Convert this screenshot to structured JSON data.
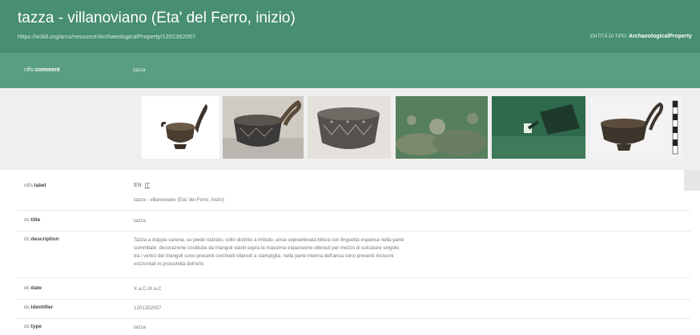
{
  "header": {
    "title": "tazza - villanoviano (Eta' del Ferro, inizio)",
    "uri": "https://w3id.org/arco/resource/ArchaeologicalProperty/1201352057",
    "entity_prefix": "ENTITÀ DI TIPO:",
    "entity_type": "ArchaeologicalProperty"
  },
  "comment": {
    "prefix": "rdfs:",
    "key": "comment",
    "value": "tazza"
  },
  "gallery": {
    "image_count": 6
  },
  "properties": {
    "label": {
      "prefix": "rdfs:",
      "key": "label",
      "lang_en": "EN",
      "lang_it": "IT",
      "value": "tazza - villanoviano (Eta' del Ferro, inizio)"
    },
    "title": {
      "prefix": "dc:",
      "key": "title",
      "value": "tazza"
    },
    "description": {
      "prefix": "dc:",
      "key": "description",
      "lines": [
        "Tazza a doppia carena, su piede rialzato, collo distinto a imbuto, ansa sopraelevata bifora con linguetta espansa nella parte",
        "sommitale; decorazione costituita da triangoli stanti sopra la massima espansione ottenuti per mezzo di solcature singole;",
        "tra i vertici dei triangoli sono presenti cerchielli ottenuti a stampiglia. nella parte interna dell'ansa sono presenti incisioni",
        "orizzontali in prossimità dell'orlo"
      ]
    },
    "date": {
      "prefix": "dc:",
      "key": "date",
      "value": "X a.C-IX a.C"
    },
    "identifier": {
      "prefix": "dc:",
      "key": "identifier",
      "value": "1201352057"
    },
    "type": {
      "prefix": "dc:",
      "key": "type",
      "value": "tazza"
    }
  },
  "colors": {
    "header": "#478e72",
    "comment_bar": "#5a9e82",
    "gallery_bg": "#efefef"
  }
}
